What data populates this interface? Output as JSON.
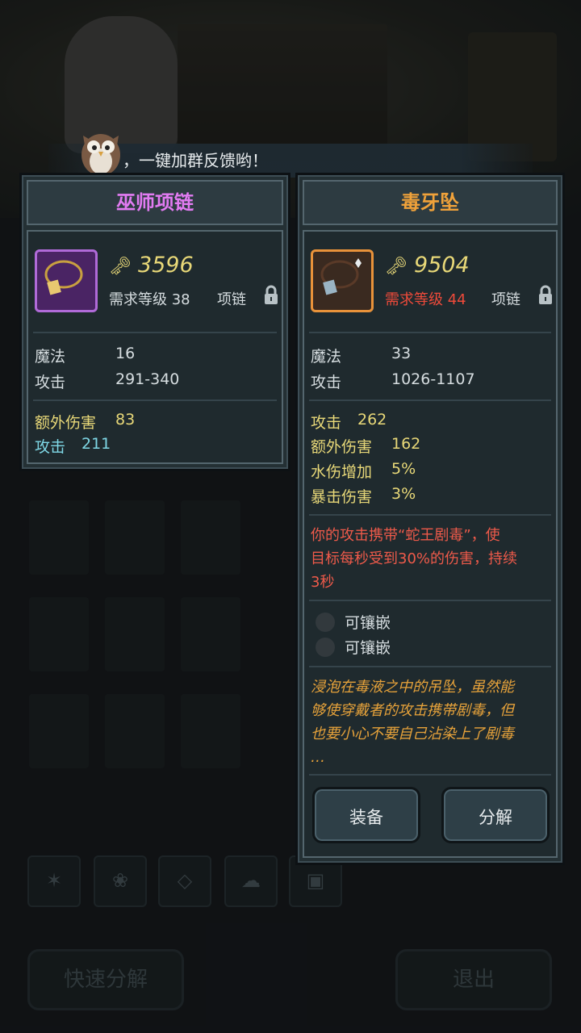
{
  "notice": {
    "text": "，一键加群反馈哟！"
  },
  "left_item": {
    "name": "巫师项链",
    "name_color": "#e27bf2",
    "icon": "necklace-icon",
    "price": "3596",
    "requirement": "需求等级 38",
    "requirement_met": true,
    "slot": "项链",
    "base_stats": [
      {
        "label": "魔法",
        "value": "16"
      },
      {
        "label": "攻击",
        "value": "291-340"
      }
    ],
    "bonus_stats": [
      {
        "label": "额外伤害",
        "value": "83",
        "color": "yellow"
      },
      {
        "label": "攻击",
        "value": "211",
        "color": "cyan"
      }
    ]
  },
  "right_item": {
    "name": "毒牙坠",
    "name_color": "#f0a23a",
    "icon": "pendant-icon",
    "price": "9504",
    "requirement": "需求等级 44",
    "requirement_met": false,
    "slot": "项链",
    "base_stats": [
      {
        "label": "魔法",
        "value": "33"
      },
      {
        "label": "攻击",
        "value": "1026-1107"
      }
    ],
    "bonus_stats": [
      {
        "label": "攻击",
        "value": "262"
      },
      {
        "label": "额外伤害",
        "value": "162"
      },
      {
        "label": "水伤增加",
        "value": "5%"
      },
      {
        "label": "暴击伤害",
        "value": "3%"
      }
    ],
    "effect_lines": [
      "你的攻击携带“蛇王剧毒”，使",
      "目标每秒受到30%的伤害，持续",
      "3秒"
    ],
    "sockets": [
      "可镶嵌",
      "可镶嵌"
    ],
    "flavor_lines": [
      "浸泡在毒液之中的吊坠，虽然能",
      "够使穿戴者的攻击携带剧毒，但",
      "也要小心不要自己沾染上了剧毒",
      "…"
    ],
    "equip_label": "装备",
    "decompose_label": "分解"
  },
  "bottom": {
    "quick_decompose_label": "快速分解",
    "exit_label": "退出"
  },
  "colors": {
    "yellow": "#e8d878",
    "cyan": "#7fd8e6",
    "red": "#ee4a3a",
    "effect": "#ee5a4a",
    "flavor": "#e6a23a"
  }
}
